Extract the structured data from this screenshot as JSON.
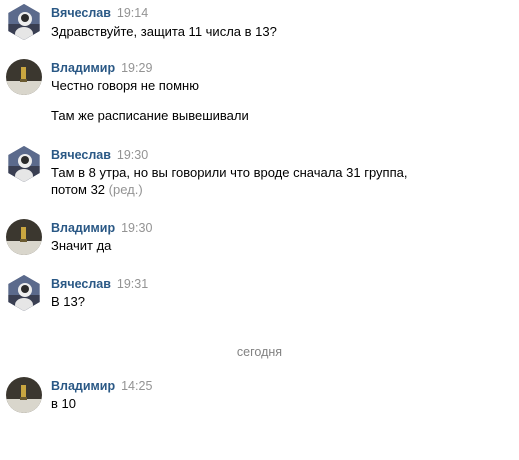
{
  "authors": {
    "vyacheslav": "Вячеслав",
    "vladimir": "Владимир"
  },
  "messages": [
    {
      "time": "19:14",
      "lines": [
        "Здравствуйте, защита 11 числа в 13?"
      ]
    },
    {
      "time": "19:29",
      "lines": [
        "Честно говоря не помню",
        "Там же расписание вывешивали"
      ]
    },
    {
      "time": "19:30",
      "lines": [
        "Там в 8 утра, но вы говорили что вроде сначала 31 группа,",
        "потом 32"
      ],
      "edited": "(ред.)"
    },
    {
      "time": "19:30",
      "lines": [
        "Значит да"
      ]
    },
    {
      "time": "19:31",
      "lines": [
        "В 13?"
      ]
    },
    {
      "time": "14:25",
      "lines": [
        "в 10"
      ]
    }
  ],
  "divider": "сегодня",
  "colors": {
    "author": "#2a5885",
    "muted": "#939393"
  }
}
